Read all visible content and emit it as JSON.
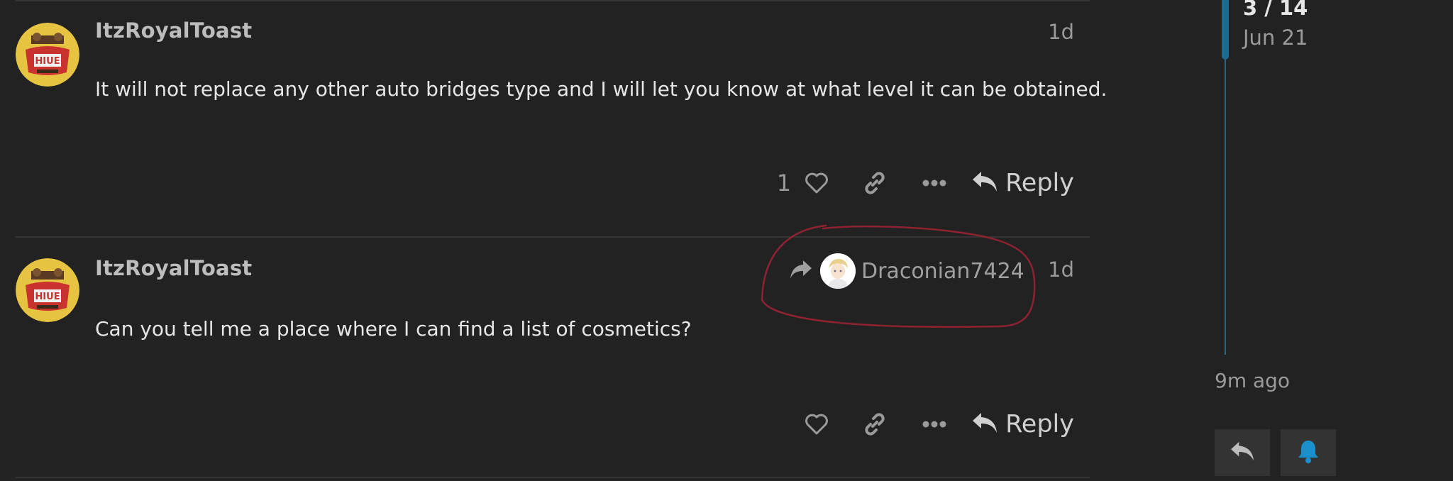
{
  "posts": [
    {
      "username": "ItzRoyalToast",
      "date": "1d",
      "body": "It will not replace any other auto bridges type and I will let you know at what level it can be obtained.",
      "like_count": "1",
      "reply_label": "Reply"
    },
    {
      "username": "ItzRoyalToast",
      "date": "1d",
      "reply_to_user": "Draconian7424",
      "body": "Can you tell me a place where I can find a list of cosmetics?",
      "reply_label": "Reply"
    }
  ],
  "avatar_text": "HIUE",
  "timeline": {
    "current": "3 / 14",
    "date": "Jun 21",
    "end_label": "9m ago"
  },
  "colors": {
    "background": "#222222",
    "accent": "#1d6a90",
    "bell": "#1a8fc9",
    "annotation": "#8e2230",
    "avatar_bg": "#e6c441",
    "avatar_banner": "#c8332e"
  },
  "icons": {
    "like": "heart-icon",
    "link": "link-icon",
    "more": "ellipsis-icon",
    "reply": "reply-icon",
    "reply_to": "share-arrow-icon",
    "bell": "bell-icon"
  }
}
